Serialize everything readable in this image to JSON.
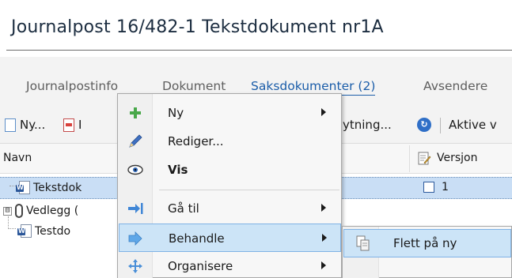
{
  "window": {
    "title": "Journalpost 16/482-1 Tekstdokument nr1A"
  },
  "tabs": [
    {
      "label": "Journalpostinfo",
      "active": false
    },
    {
      "label": "Dokument",
      "active": false
    },
    {
      "label": "Saksdokumenter (2)",
      "active": true
    },
    {
      "label": "Avsendere",
      "active": false
    }
  ],
  "toolbar": {
    "new_label": "Ny...",
    "partial_label": "I",
    "layout_label": "ytning...",
    "active_label": "Aktive v"
  },
  "grid": {
    "columns": {
      "name": "Navn",
      "version": "Versjon"
    },
    "rows": [
      {
        "name": "Tekstdok",
        "version": "1",
        "selected": true
      },
      {
        "name": "Vedlegg (",
        "expander": "⊟"
      },
      {
        "name": "Testdo"
      }
    ]
  },
  "context_menu": {
    "items": [
      {
        "label": "Ny",
        "icon": "plus-icon",
        "submenu": true
      },
      {
        "label": "Rediger...",
        "icon": "pencil-icon"
      },
      {
        "label": "Vis",
        "icon": "eye-icon",
        "bold": true
      },
      {
        "label": "Gå til",
        "icon": "goto-arrow-icon",
        "submenu": true
      },
      {
        "label": "Behandle",
        "icon": "process-arrow-icon",
        "submenu": true,
        "highlighted": true
      },
      {
        "label": "Organisere",
        "icon": "move-icon",
        "submenu": true
      }
    ]
  },
  "submenu": {
    "items": [
      {
        "label": "Flett på ny",
        "icon": "merge-icon",
        "highlighted": true
      }
    ]
  },
  "colors": {
    "accent": "#1b5da9",
    "selection": "#c9def5",
    "menu_highlight": "#cce4f7",
    "title_text": "#1c2d40"
  }
}
